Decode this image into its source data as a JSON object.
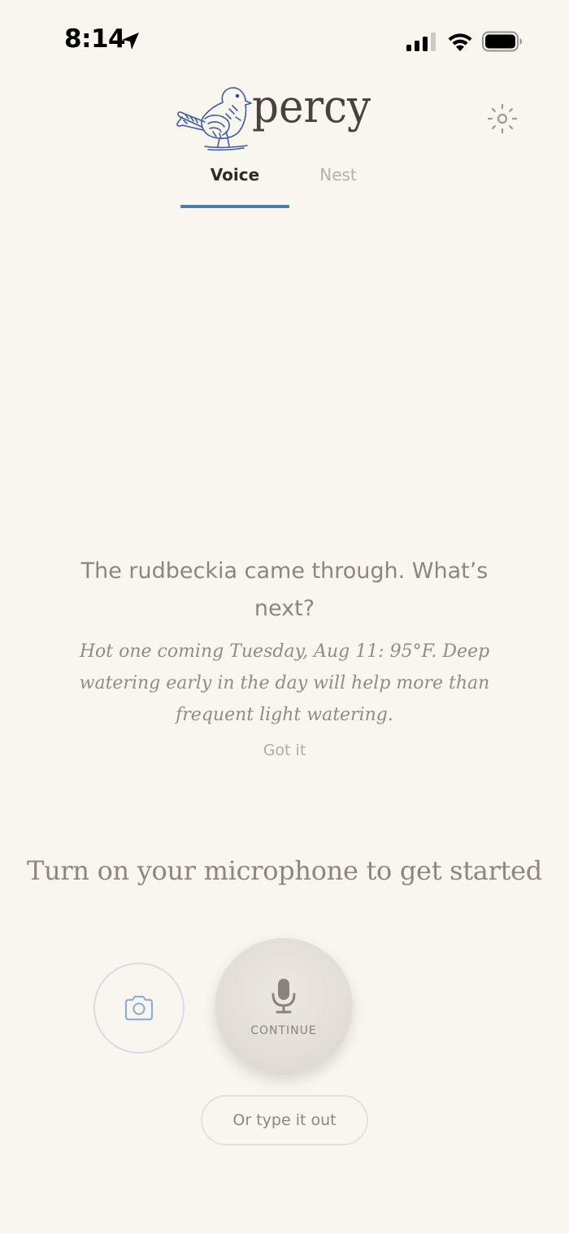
{
  "status_bar": {
    "time": "8:14"
  },
  "header": {
    "brand": "percy"
  },
  "tabs": [
    {
      "label": "Voice",
      "active": true
    },
    {
      "label": "Nest",
      "active": false
    }
  ],
  "message": {
    "headline": "The rudbeckia came through. What’s next?",
    "tip": "Hot one coming Tuesday, Aug 11: 95°F. Deep watering early in the day will help more than frequent light watering.",
    "dismiss_label": "Got it"
  },
  "prompt": "Turn on your microphone to get started",
  "actions": {
    "mic_label": "CONTINUE",
    "type_label": "Or type it out"
  },
  "colors": {
    "background": "#f9f6f0",
    "accent": "#4a7db0",
    "text_muted": "#8f8480"
  },
  "icons": [
    "location-arrow-icon",
    "cellular-signal-icon",
    "wifi-icon",
    "battery-icon",
    "bird-logo",
    "gear-icon",
    "camera-icon",
    "microphone-icon"
  ]
}
